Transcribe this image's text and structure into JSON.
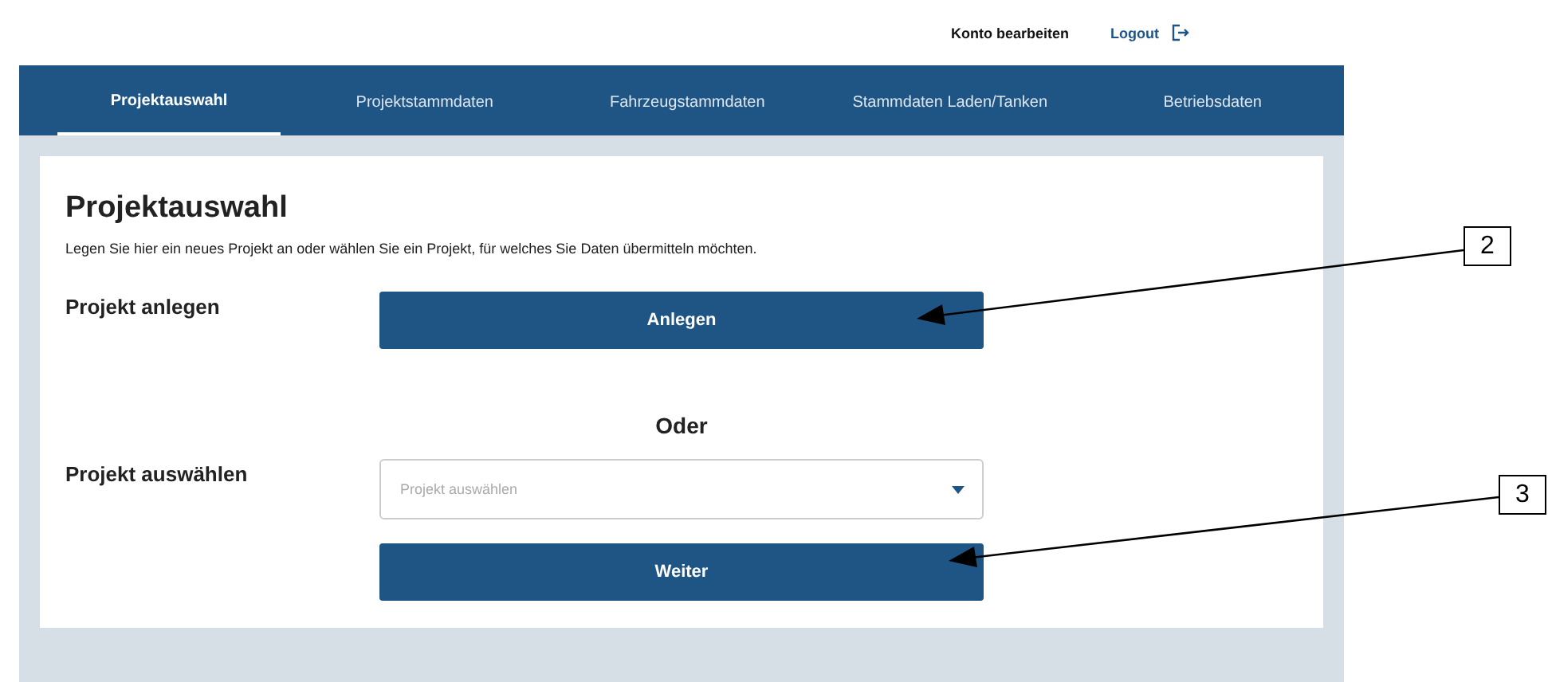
{
  "header": {
    "account_link": "Konto bearbeiten",
    "logout_link": "Logout"
  },
  "tabs": [
    {
      "label": "Projektauswahl",
      "selected": true
    },
    {
      "label": "Projektstammdaten",
      "selected": false
    },
    {
      "label": "Fahrzeugstammdaten",
      "selected": false
    },
    {
      "label": "Stammdaten Laden/Tanken",
      "selected": false
    },
    {
      "label": "Betriebsdaten",
      "selected": false
    }
  ],
  "page": {
    "title": "Projektauswahl",
    "description": "Legen Sie hier ein neues Projekt an oder wählen Sie ein Projekt, für welches Sie Daten übermitteln möchten.",
    "create_label": "Projekt anlegen",
    "create_button": "Anlegen",
    "or_label": "Oder",
    "select_label": "Projekt auswählen",
    "select_placeholder": "Projekt auswählen",
    "next_button": "Weiter"
  },
  "callouts": [
    {
      "number": "2"
    },
    {
      "number": "3"
    }
  ]
}
